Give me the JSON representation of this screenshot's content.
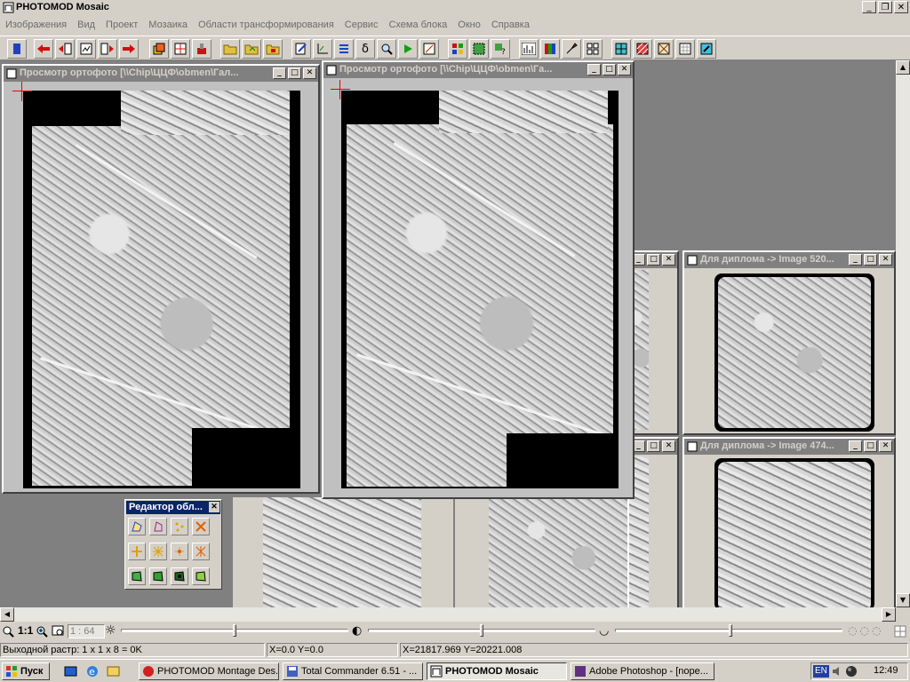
{
  "app": {
    "title": "PHOTOMOD Mosaic"
  },
  "menu": [
    "Изображения",
    "Вид",
    "Проект",
    "Мозаика",
    "Области трансформирования",
    "Сервис",
    "Схема блока",
    "Окно",
    "Справка"
  ],
  "windows": {
    "ortho1_title": "Просмотр ортофото [\\\\Chip\\ЦЦФ\\obmen\\Гал...",
    "ortho2_title": "Просмотр ортофото [\\\\Chip\\ЦЦФ\\obmen\\Га...",
    "diploma1_title": "Для диплома -> Image 520...",
    "diploma2_title": "Для диплома -> Image 474..."
  },
  "palette": {
    "title": "Редактор обл..."
  },
  "zoom": {
    "one_to_one": "1:1",
    "scale": "1 : 64"
  },
  "status": {
    "raster": "Выходной растр: 1 x 1 x 8 = 0K",
    "xy": "X=0.0 Y=0.0",
    "world_xy": "X=21817.969 Y=20221.008"
  },
  "taskbar": {
    "start": "Пуск",
    "tasks": [
      "PHOTOMOD Montage Des...",
      "Total Commander 6.51 - ...",
      "PHOTOMOD Mosaic",
      "Adobe Photoshop - [nope..."
    ],
    "lang": "EN",
    "clock": "12:49"
  },
  "colors": {
    "accent": "#0a246a",
    "inactive_title": "#808080",
    "crosshair": "#e00000"
  }
}
